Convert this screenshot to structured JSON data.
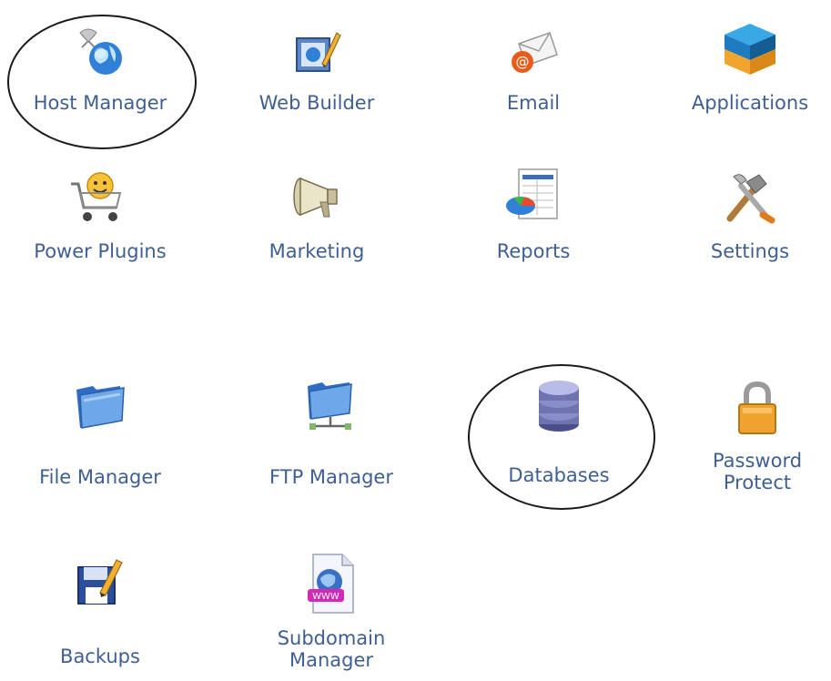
{
  "tiles": {
    "host_manager": {
      "label": "Host Manager",
      "icon": "globe-network-icon"
    },
    "web_builder": {
      "label": "Web Builder",
      "icon": "web-builder-icon"
    },
    "email": {
      "label": "Email",
      "icon": "email-envelope-icon"
    },
    "applications": {
      "label": "Applications",
      "icon": "blocks-stack-icon"
    },
    "power_plugins": {
      "label": "Power Plugins",
      "icon": "shopping-cart-icon"
    },
    "marketing": {
      "label": "Marketing",
      "icon": "megaphone-icon"
    },
    "reports": {
      "label": "Reports",
      "icon": "report-chart-icon"
    },
    "settings": {
      "label": "Settings",
      "icon": "hammer-wrench-icon"
    },
    "file_manager": {
      "label": "File Manager",
      "icon": "folder-icon"
    },
    "ftp_manager": {
      "label": "FTP Manager",
      "icon": "network-folder-icon"
    },
    "databases": {
      "label": "Databases",
      "icon": "database-icon"
    },
    "password_protect": {
      "label_line1": "Password",
      "label_line2": "Protect",
      "icon": "padlock-icon"
    },
    "backups": {
      "label": "Backups",
      "icon": "floppy-pencil-icon"
    },
    "subdomain_manager": {
      "label_line1": "Subdomain",
      "label_line2": "Manager",
      "icon": "subdomain-document-icon"
    }
  },
  "annotations": {
    "circled_items": [
      "Host Manager",
      "Databases"
    ]
  },
  "colors": {
    "label": "#3f5f92",
    "annotation_ring": "#1b1b1b",
    "background": "#ffffff"
  }
}
